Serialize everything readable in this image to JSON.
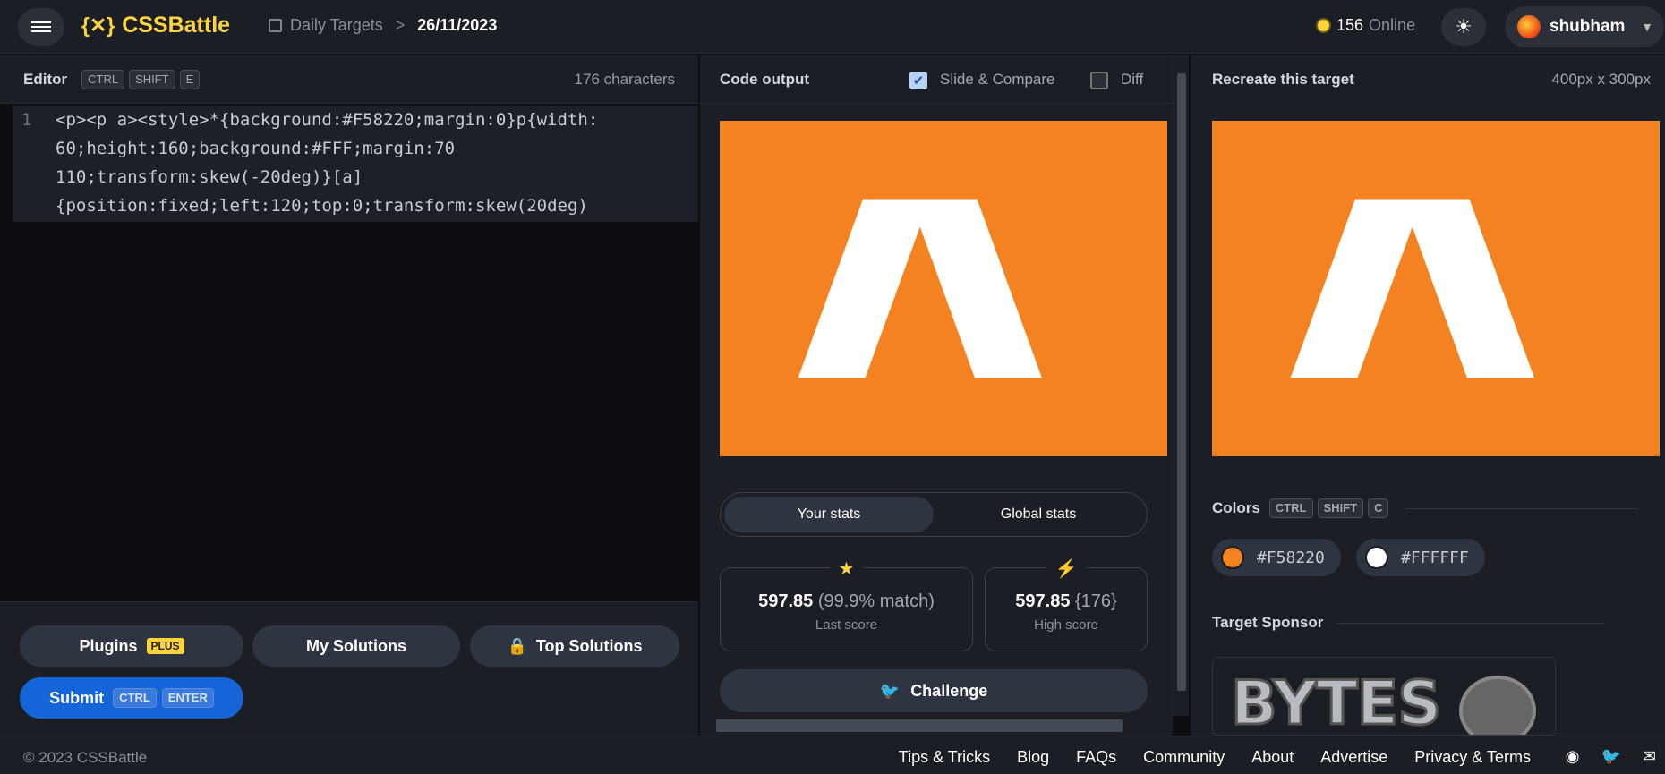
{
  "header": {
    "logo_mark": "{✕}",
    "logo_text": "CSSBattle",
    "breadcrumb_section": "Daily Targets",
    "breadcrumb_sep": ">",
    "breadcrumb_current": "26/11/2023",
    "online_count": "156",
    "online_label": "Online",
    "username": "shubham"
  },
  "editor": {
    "title": "Editor",
    "shortcut_keys": [
      "CTRL",
      "SHIFT",
      "E"
    ],
    "char_count": "176 characters",
    "line_number": "1",
    "code_lines": [
      "<p><p a><style>*{background:#F58220;margin:0}p{width:",
      "60;height:160;background:#FFF;margin:70",
      "110;transform:skew(-20deg)}[a]",
      "{position:fixed;left:120;top:0;transform:skew(20deg)"
    ],
    "plugins_label": "Plugins",
    "plugins_badge": "PLUS",
    "my_solutions_label": "My Solutions",
    "top_solutions_label": "Top Solutions",
    "submit_label": "Submit",
    "submit_keys": [
      "CTRL",
      "ENTER"
    ]
  },
  "output": {
    "title": "Code output",
    "slide_compare_label": "Slide & Compare",
    "slide_compare_checked": true,
    "diff_label": "Diff",
    "diff_checked": false,
    "tab_your_stats": "Your stats",
    "tab_global_stats": "Global stats",
    "last_score_value": "597.85",
    "last_score_match": "(99.9% match)",
    "last_score_label": "Last score",
    "high_score_value": "597.85",
    "high_score_chars": "{176}",
    "high_score_label": "High score",
    "challenge_label": "Challenge"
  },
  "target": {
    "title": "Recreate this target",
    "dimensions": "400px x 300px",
    "colors_title": "Colors",
    "colors_keys": [
      "CTRL",
      "SHIFT",
      "C"
    ],
    "colors": [
      {
        "hex": "#F58220"
      },
      {
        "hex": "#FFFFFF"
      }
    ],
    "sponsor_title": "Target Sponsor",
    "sponsor_text": "BYTES"
  },
  "footer": {
    "copyright": "© 2023 CSSBattle",
    "links": [
      "Tips & Tricks",
      "Blog",
      "FAQs",
      "Community",
      "About",
      "Advertise",
      "Privacy & Terms"
    ]
  },
  "theme": {
    "accent_yellow": "#ffd53d",
    "submit_blue": "#1565d8",
    "target_bg": "#F58220",
    "target_fg": "#FFFFFF"
  }
}
